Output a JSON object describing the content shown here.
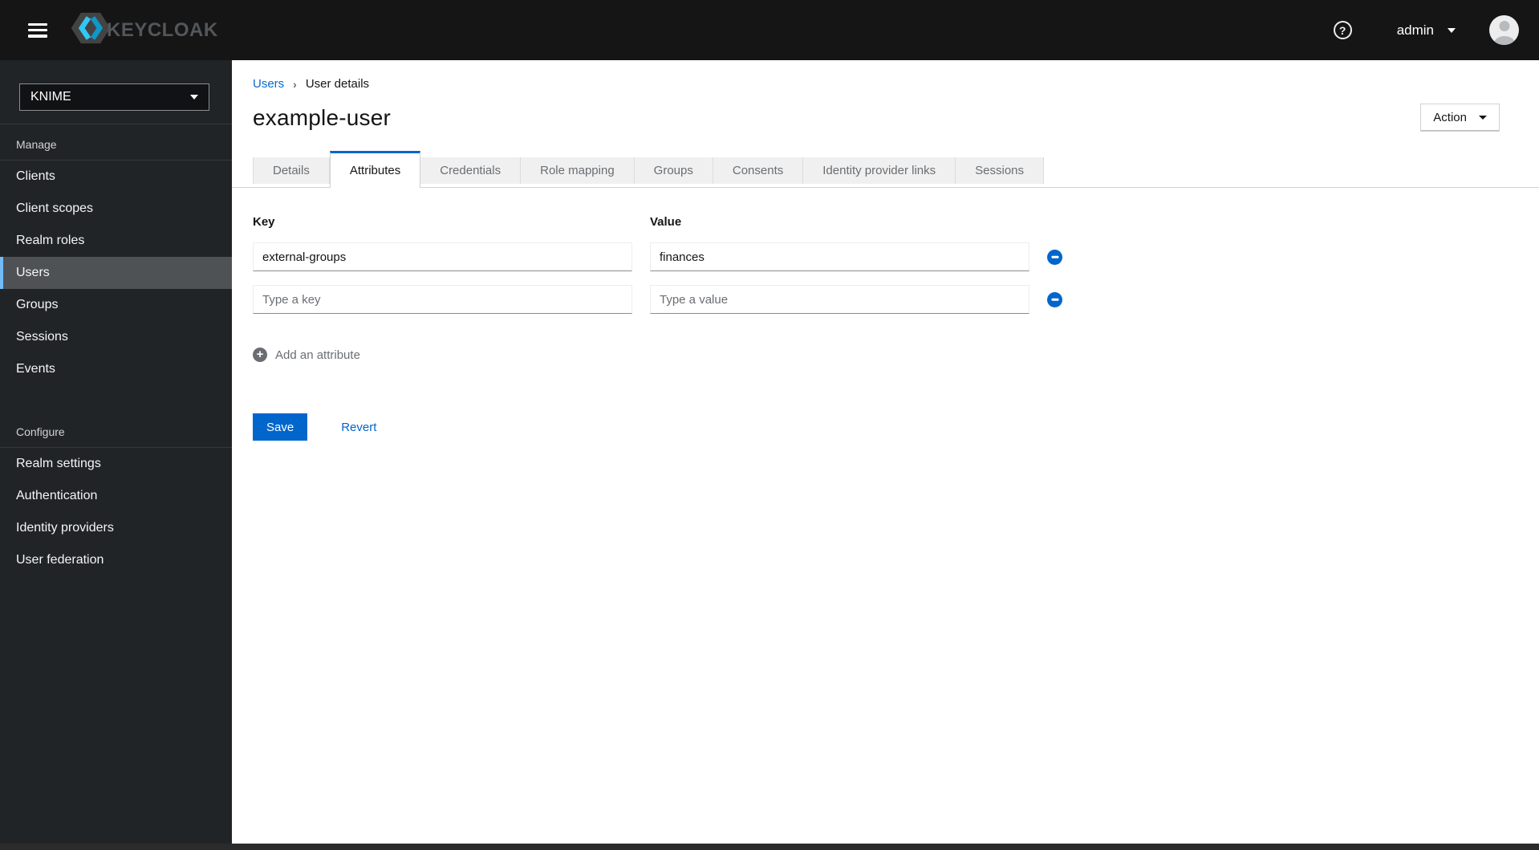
{
  "topbar": {
    "brand": "KEYCLOAK",
    "username": "admin",
    "icons": {
      "menu": "hamburger",
      "help": "question-circle",
      "user_caret": "caret-down",
      "avatar": "user-avatar"
    }
  },
  "sidebar": {
    "realm_selector": "KNIME",
    "sections": [
      {
        "title": "Manage",
        "items": [
          {
            "label": "Clients",
            "selected": false
          },
          {
            "label": "Client scopes",
            "selected": false
          },
          {
            "label": "Realm roles",
            "selected": false
          },
          {
            "label": "Users",
            "selected": true
          },
          {
            "label": "Groups",
            "selected": false
          },
          {
            "label": "Sessions",
            "selected": false
          },
          {
            "label": "Events",
            "selected": false
          }
        ]
      },
      {
        "title": "Configure",
        "items": [
          {
            "label": "Realm settings",
            "selected": false
          },
          {
            "label": "Authentication",
            "selected": false
          },
          {
            "label": "Identity providers",
            "selected": false
          },
          {
            "label": "User federation",
            "selected": false
          }
        ]
      }
    ]
  },
  "breadcrumb": {
    "parent": "Users",
    "current": "User details"
  },
  "page_header": {
    "title": "example-user",
    "action_button": "Action"
  },
  "tabs": {
    "active": "Attributes",
    "items": [
      "Details",
      "Attributes",
      "Credentials",
      "Role mapping",
      "Groups",
      "Consents",
      "Identity provider links",
      "Sessions"
    ]
  },
  "attributes_form": {
    "key_header": "Key",
    "value_header": "Value",
    "rows": [
      {
        "key": "external-groups",
        "value": "finances",
        "key_placeholder": "",
        "value_placeholder": ""
      },
      {
        "key": "",
        "value": "",
        "key_placeholder": "Type a key",
        "value_placeholder": "Type a value"
      }
    ],
    "add_attribute_label": "Add an attribute",
    "save_button": "Save",
    "revert_button": "Revert"
  },
  "colors": {
    "accent_blue": "#0066cc",
    "topbar_bg": "#151515",
    "sidebar_bg": "#212427",
    "selected_nav_bg": "#4f5255",
    "selected_nav_border": "#73bcf7",
    "tab_inactive_bg": "#f0f0f0",
    "logo_cyan": "#32c6f4",
    "logo_blue": "#0f97c9"
  }
}
